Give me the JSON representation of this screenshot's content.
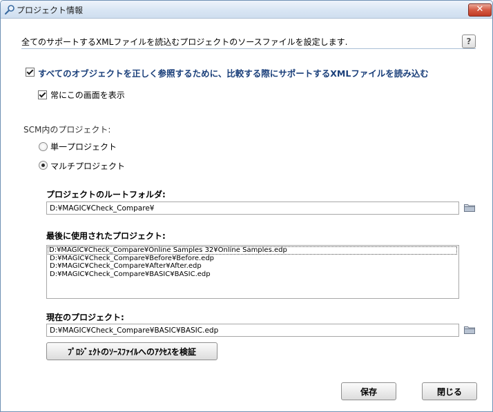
{
  "window": {
    "title": "プロジェクト情報",
    "close_glyph": "✕"
  },
  "header": {
    "description": "全てのサポートするXMLファイルを読込むプロジェクトのソースファイルを設定します.",
    "help_glyph": "?"
  },
  "options": {
    "load_xml_label": "すべてのオブジェクトを正しく参照するために、比較する際にサポートするXMLファイルを読み込む",
    "load_xml_checked": true,
    "always_show_label": "常にこの画面を表示",
    "always_show_checked": true
  },
  "scm": {
    "group_label": "SCM内のプロジェクト:",
    "single_label": "単一プロジェクト",
    "multi_label": "マルチプロジェクト",
    "selected": "multi"
  },
  "root_folder": {
    "label": "プロジェクトのルートフォルダ:",
    "value": "D:¥MAGIC¥Check_Compare¥"
  },
  "recent": {
    "label": "最後に使用されたプロジェクト:",
    "items": [
      "D:¥MAGIC¥Check_Compare¥Online Samples 32¥Online Samples.edp",
      "D:¥MAGIC¥Check_Compare¥Before¥Before.edp",
      "D:¥MAGIC¥Check_Compare¥After¥After.edp",
      "D:¥MAGIC¥Check_Compare¥BASIC¥BASIC.edp"
    ]
  },
  "current": {
    "label": "現在のプロジェクト:",
    "value": "D:¥MAGIC¥Check_Compare¥BASIC¥BASIC.edp"
  },
  "buttons": {
    "verify": "ﾌﾟﾛｼﾞｪｸﾄのｿｰｽﾌｧｲﾙへのｱｸｾｽを検証",
    "save": "保存",
    "close": "閉じる"
  }
}
